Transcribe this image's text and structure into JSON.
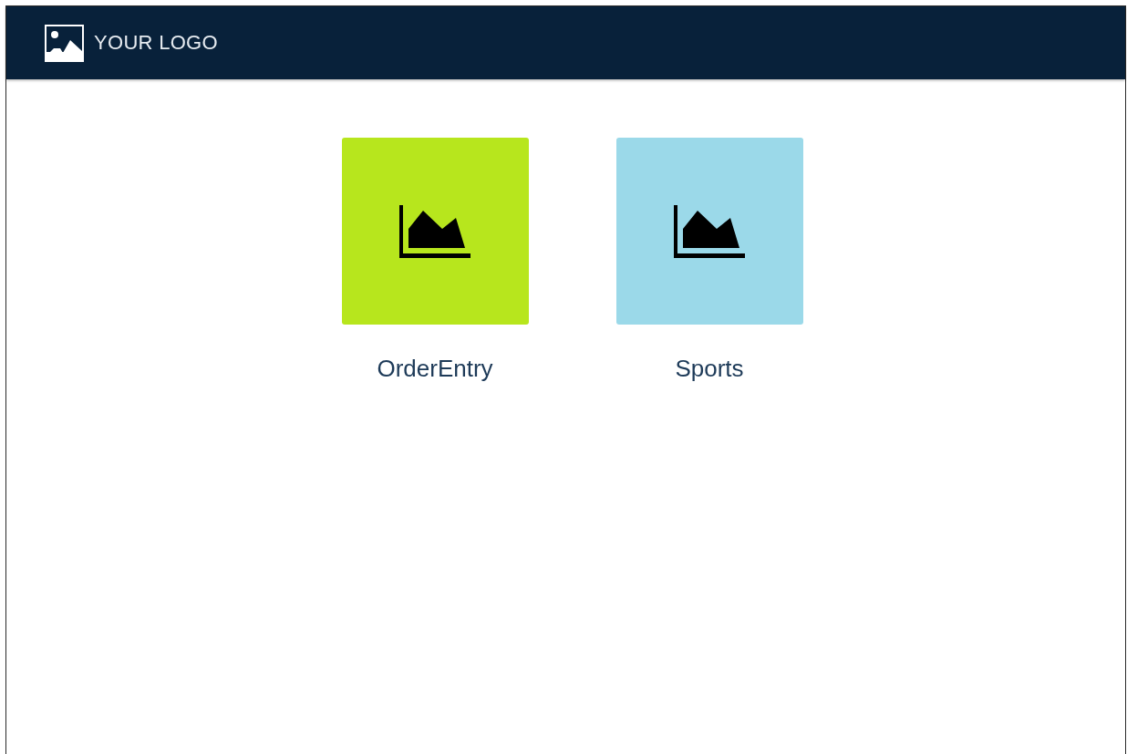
{
  "header": {
    "logo_text": "YOUR LOGO"
  },
  "apps": [
    {
      "label": "OrderEntry",
      "color": "#b7e61d"
    },
    {
      "label": "Sports",
      "color": "#9bd9e9"
    }
  ]
}
